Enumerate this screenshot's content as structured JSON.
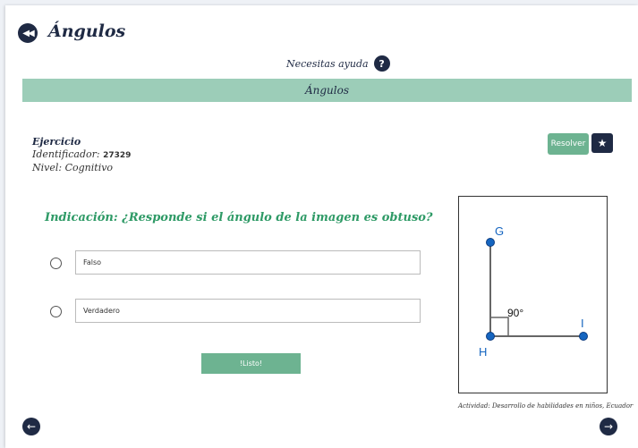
{
  "header": {
    "title": "Ángulos",
    "help_label": "Necesitas ayuda",
    "help_icon": "?"
  },
  "banner": {
    "title": "Ángulos"
  },
  "exercise": {
    "heading": "Ejercicio",
    "id_label": "Identificador:",
    "id_value": "27329",
    "level_label": "Nivel:",
    "level_value": "Cognitivo"
  },
  "actions": {
    "resolver_label": "Resolver",
    "star_icon": "star-icon"
  },
  "question": {
    "text": "Indicación: ¿Responde si el ángulo de la imagen es obtuso?"
  },
  "options": [
    {
      "label": "Falso"
    },
    {
      "label": "Verdadero"
    }
  ],
  "submit": {
    "label": "!Listo!"
  },
  "figure": {
    "point_g": "G",
    "point_h": "H",
    "point_i": "I",
    "angle_label": "90°"
  },
  "caption": "Actividad: Desarrollo de habilidades en niños, Ecuador",
  "colors": {
    "navy": "#1f2a44",
    "green": "#6db391",
    "banner": "#9ccdb8",
    "indicacion": "#2e9a66",
    "point_blue": "#1565c0"
  }
}
